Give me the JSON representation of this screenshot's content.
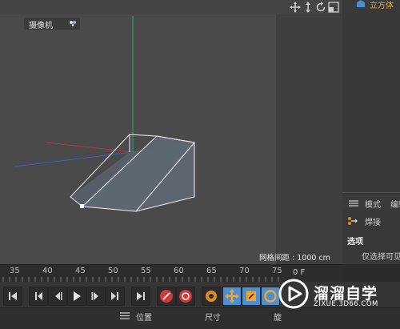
{
  "viewport": {
    "camera_label": "摄像机",
    "grid_spacing": "网格间距 : 1000 cm"
  },
  "object_manager": {
    "object_label": "立方体"
  },
  "attributes": {
    "mode_label": "模式",
    "edit_label": "编辑",
    "weld_label": "焊接",
    "options_label": "选项",
    "only_select_visible": "仅选择可见"
  },
  "timeline": {
    "ticks": [
      "35",
      "40",
      "45",
      "50",
      "55",
      "60",
      "65",
      "70",
      "75"
    ],
    "frame_readout": "0 F"
  },
  "transport": {
    "buttons": [
      "go-start",
      "prev-key",
      "prev-frame",
      "play",
      "next-frame",
      "next-key",
      "go-end",
      "record",
      "autokey",
      "keyframe-selection",
      "move-key",
      "scale-key",
      "rotate-key"
    ]
  },
  "coordinates": {
    "position_label": "位置",
    "size_label": "尺寸",
    "rotation_label": "旋"
  },
  "watermark": {
    "title": "溜溜自学",
    "url": "ZIXUE.3D66.COM"
  },
  "colors": {
    "viewport_bg": "#4a4a4a",
    "axis_y": "#2fae6a",
    "axis_x": "#b23b3b",
    "axis_z": "#3a62b8",
    "active_object": "#f0a030",
    "record_red": "#d23a3a",
    "key_orange": "#e08a20",
    "move_blue": "#4a90d9"
  }
}
